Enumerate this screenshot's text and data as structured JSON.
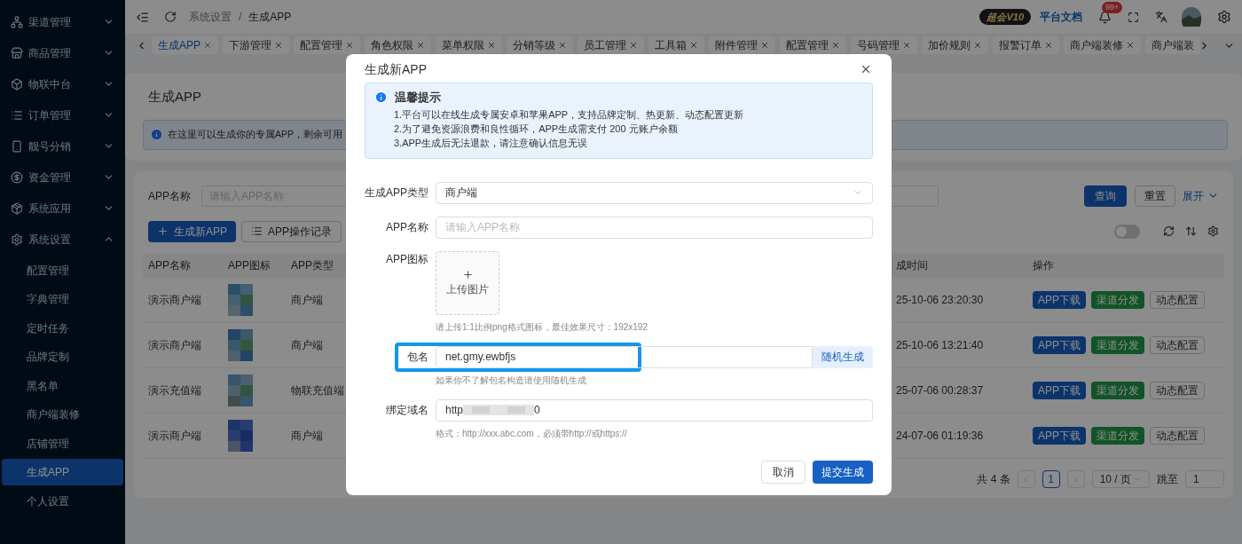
{
  "sidebar": {
    "items": [
      {
        "label": "渠道管理",
        "expanded": false
      },
      {
        "label": "商品管理",
        "expanded": false
      },
      {
        "label": "物联中台",
        "expanded": false
      },
      {
        "label": "订单管理",
        "expanded": false
      },
      {
        "label": "靓号分销",
        "expanded": false
      },
      {
        "label": "资金管理",
        "expanded": false
      },
      {
        "label": "系统应用",
        "expanded": false
      },
      {
        "label": "系统设置",
        "expanded": true,
        "children": [
          {
            "label": "配置管理",
            "selected": false
          },
          {
            "label": "字典管理",
            "selected": false
          },
          {
            "label": "定时任务",
            "selected": false
          },
          {
            "label": "品牌定制",
            "selected": false
          },
          {
            "label": "黑名单",
            "selected": false
          },
          {
            "label": "商户端装修",
            "selected": false
          },
          {
            "label": "店铺管理",
            "selected": false
          },
          {
            "label": "生成APP",
            "selected": true
          },
          {
            "label": "个人设置",
            "selected": false
          }
        ]
      }
    ]
  },
  "header": {
    "breadcrumb": [
      "系统设置",
      "生成APP"
    ],
    "separator": "/",
    "vip_badge": "超会V10",
    "docs_link": "平台文档",
    "notification_count": "99+"
  },
  "tabs": [
    {
      "label": "生成APP",
      "selected": true
    },
    {
      "label": "下游管理",
      "selected": false
    },
    {
      "label": "配置管理",
      "selected": false
    },
    {
      "label": "角色权限",
      "selected": false
    },
    {
      "label": "菜单权限",
      "selected": false
    },
    {
      "label": "分销等级",
      "selected": false
    },
    {
      "label": "员工管理",
      "selected": false
    },
    {
      "label": "工具箱",
      "selected": false
    },
    {
      "label": "附件管理",
      "selected": false
    },
    {
      "label": "配置管理",
      "selected": false
    },
    {
      "label": "号码管理",
      "selected": false
    },
    {
      "label": "加价规则",
      "selected": false
    },
    {
      "label": "报警订单",
      "selected": false
    },
    {
      "label": "商户端装修",
      "selected": false
    },
    {
      "label": "商户端装",
      "selected": false
    }
  ],
  "page": {
    "title": "生成APP",
    "notice": "在这里可以生成你的专属APP，剩余可用",
    "search": {
      "label": "APP名称",
      "placeholder": "请输入APP名称",
      "query_button": "查询",
      "reset_button": "重置",
      "expand_link": "展开"
    },
    "toolbar": {
      "create_button": "生成新APP",
      "log_button": "APP操作记录",
      "toggle_on": false
    },
    "table": {
      "columns": [
        "APP名称",
        "APP图标",
        "APP类型",
        "成时间",
        "操作"
      ],
      "rows": [
        {
          "name": "演示商户端",
          "type": "商户端",
          "time": "25-10-06 23:20:30",
          "actions": [
            "APP下载",
            "渠道分发",
            "动态配置"
          ]
        },
        {
          "name": "演示商户端",
          "type": "商户端",
          "time": "25-10-06 13:21:40",
          "actions": [
            "APP下载",
            "渠道分发",
            "动态配置"
          ]
        },
        {
          "name": "演示充值端",
          "type": "物联充值端",
          "time": "25-07-06 00:28:37",
          "actions": [
            "APP下载",
            "渠道分发",
            "动态配置"
          ]
        },
        {
          "name": "演示商户端",
          "type": "商户端",
          "time": "24-07-06 01:19:36",
          "actions": [
            "APP下载",
            "渠道分发",
            "动态配置"
          ]
        }
      ]
    },
    "pagination": {
      "total": "共 4 条",
      "page": "1",
      "page_size": "10 / 页",
      "jump_label": "跳至",
      "jump_value": "1"
    }
  },
  "modal": {
    "title": "生成新APP",
    "tip": {
      "title": "温馨提示",
      "lines": [
        "1.平台可以在线生成专属安卓和苹果APP，支持品牌定制、热更新、动态配置更新",
        "2.为了避免资源浪费和良性循环，APP生成需支付 200 元账户余额",
        "3.APP生成后无法退款，请注意确认信息无误"
      ]
    },
    "fields": [
      {
        "kind": "select",
        "label": "生成APP类型",
        "value": "商户端"
      },
      {
        "kind": "input",
        "label": "APP名称",
        "placeholder": "请输入APP名称"
      },
      {
        "kind": "upload",
        "label": "APP图标",
        "upload_text": "上传图片",
        "hint": "请上传1:1比例png格式图标，最佳效果尺寸：192x192"
      },
      {
        "kind": "addon",
        "label": "包名",
        "value": "net.gmy.ewbfjs",
        "addon": "随机生成",
        "highlighted": true,
        "hint": "如果你不了解包名构造请使用随机生成"
      },
      {
        "kind": "redacted",
        "label": "绑定域名",
        "value_start": "http",
        "value_end": "0",
        "hint": "格式：http://xxx.abc.com，必须带http://或https://"
      }
    ],
    "cancel_button": "取消",
    "submit_button": "提交生成"
  }
}
